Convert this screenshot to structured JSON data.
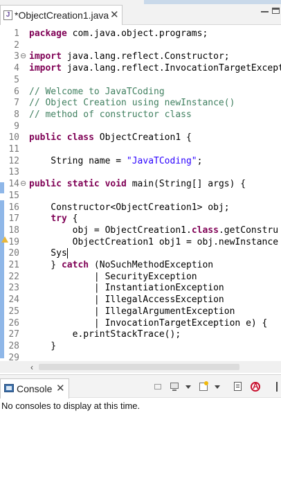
{
  "editor_tab": {
    "label": "*ObjectCreation1.java",
    "close": "✕",
    "file_icon_letter": "J"
  },
  "code_lines": [
    {
      "n": "1",
      "html": "<span class=\"kw\">package</span> com.java.object.programs;"
    },
    {
      "n": "2",
      "html": ""
    },
    {
      "n": "3",
      "fold": "⊖",
      "html": "<span class=\"kw\">import</span> java.lang.reflect.Constructor;"
    },
    {
      "n": "4",
      "html": "<span class=\"kw\">import</span> java.lang.reflect.InvocationTargetExcept"
    },
    {
      "n": "5",
      "html": ""
    },
    {
      "n": "6",
      "html": "<span class=\"cm\">// Welcome to JavaTCoding</span>"
    },
    {
      "n": "7",
      "html": "<span class=\"cm\">// Object Creation using newInstance()</span>"
    },
    {
      "n": "8",
      "html": "<span class=\"cm\">// method of constructor class</span>"
    },
    {
      "n": "9",
      "html": ""
    },
    {
      "n": "10",
      "html": "<span class=\"kw\">public class</span> ObjectCreation1 {"
    },
    {
      "n": "11",
      "html": ""
    },
    {
      "n": "12",
      "html": "    String name = <span class=\"st\">\"JavaTCoding\"</span>;"
    },
    {
      "n": "13",
      "html": ""
    },
    {
      "n": "14",
      "fold": "⊖",
      "html": "<span class=\"kw\">public static void</span> main(String[] args) {"
    },
    {
      "n": "15",
      "html": ""
    },
    {
      "n": "16",
      "html": "    Constructor&lt;ObjectCreation1&gt; obj;"
    },
    {
      "n": "17",
      "html": "    <span class=\"kw\">try</span> {"
    },
    {
      "n": "18",
      "html": "        obj = ObjectCreation1.<span class=\"kw\">class</span>.getConstru"
    },
    {
      "n": "19",
      "html": "        ObjectCreation1 obj1 = obj.newInstance"
    },
    {
      "n": "20",
      "html": "    Sys<span class=\"cursor\"></span>"
    },
    {
      "n": "21",
      "html": "    } <span class=\"kw\">catch</span> (NoSuchMethodException"
    },
    {
      "n": "22",
      "html": "            | SecurityException"
    },
    {
      "n": "23",
      "html": "            | InstantiationException"
    },
    {
      "n": "24",
      "html": "            | IllegalAccessException"
    },
    {
      "n": "25",
      "html": "            | IllegalArgumentException"
    },
    {
      "n": "26",
      "html": "            | InvocationTargetException e) {"
    },
    {
      "n": "27",
      "html": "        e.printStackTrace();"
    },
    {
      "n": "28",
      "html": "    }"
    },
    {
      "n": "29",
      "html": ""
    }
  ],
  "console": {
    "tab_label": "Console",
    "close": "✕",
    "message": "No consoles to display at this time."
  },
  "colors": {
    "keyword": "#7f0055",
    "comment": "#3f7f5f",
    "string": "#2a00ff",
    "line_number": "#787878",
    "gutter_marker": "#8fb7e8"
  }
}
